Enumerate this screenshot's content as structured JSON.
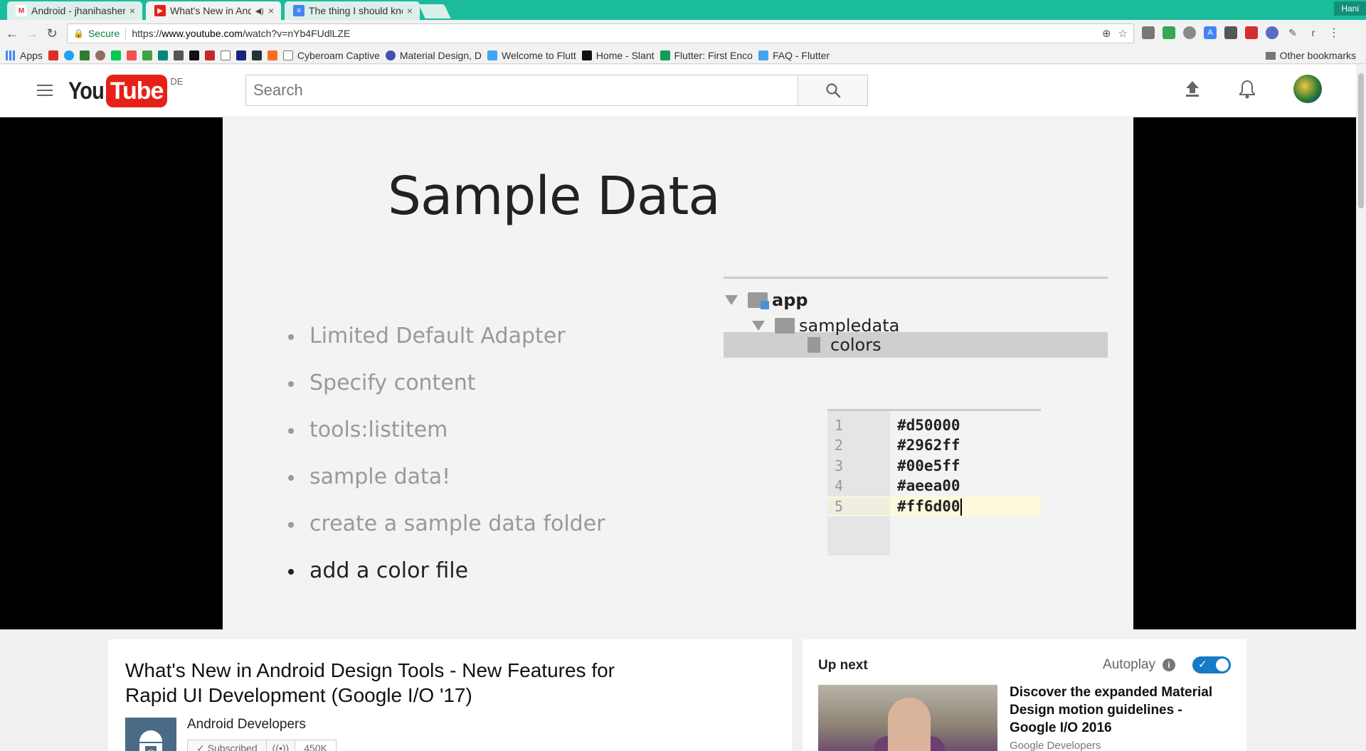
{
  "browser": {
    "tabs": [
      {
        "title": "Android - jhanihashemi@gmail.com",
        "favicon_color": "#d93025",
        "active": false
      },
      {
        "title": "What's New in Android Design Tools",
        "favicon_color": "#e62117",
        "active": true
      },
      {
        "title": "The thing I should know",
        "favicon_color": "#4285f4",
        "active": false
      }
    ],
    "close_glyph": "×",
    "audio_glyph": "◀)",
    "profile_name": "Hani",
    "secure_label": "Secure",
    "url_scheme": "https://",
    "url_host": "www.youtube.com",
    "url_path": "/watch?v=nYb4FUdlLZE",
    "bookmarks": {
      "apps_label": "Apps",
      "items": [
        {
          "label": "Cyberoam Captive",
          "color": "#666666"
        },
        {
          "label": "Material Design, D",
          "color": "#3f51b5"
        },
        {
          "label": "Welcome to Flutt",
          "color": "#42a5f5"
        },
        {
          "label": "Home - Slant",
          "color": "#111111"
        },
        {
          "label": "Flutter: First Enco",
          "color": "#0f9d58"
        },
        {
          "label": "FAQ - Flutter",
          "color": "#42a5f5"
        }
      ],
      "other_label": "Other bookmarks"
    }
  },
  "youtube": {
    "logo_you": "You",
    "logo_tube": "Tube",
    "region": "DE",
    "search_placeholder": "Search"
  },
  "slide": {
    "title": "Sample Data",
    "bullets": [
      "Limited Default Adapter",
      "Specify content",
      "tools:listitem",
      "sample data!",
      "create a sample data folder",
      "add a color file"
    ],
    "tree": {
      "root": "app",
      "folder": "sampledata",
      "file": "colors"
    },
    "code_lines": [
      {
        "n": "1",
        "text": "#d50000"
      },
      {
        "n": "2",
        "text": "#2962ff"
      },
      {
        "n": "3",
        "text": "#00e5ff"
      },
      {
        "n": "4",
        "text": "#aeea00"
      },
      {
        "n": "5",
        "text": "#ff6d00"
      }
    ]
  },
  "video": {
    "title": "What's New in Android Design Tools - New Features for Rapid UI Development (Google I/O '17)",
    "channel": "Android Developers",
    "subscribe_label": "✓ Subscribed",
    "sub_count": "450K"
  },
  "upnext": {
    "label": "Up next",
    "autoplay_label": "Autoplay",
    "autoplay_on": true,
    "item_title": "Discover the expanded Material Design motion guidelines - Google I/O 2016",
    "item_channel": "Google Developers"
  },
  "colors": {
    "tabstrip": "#1abc9c",
    "youtube_red": "#e62117",
    "toggle_blue": "#167ac6"
  }
}
